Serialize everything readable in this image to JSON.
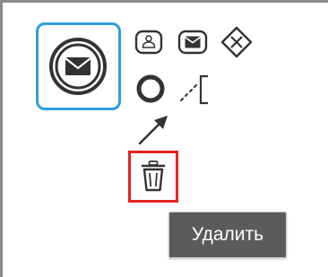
{
  "palette_icons": {
    "selected_shape": "envelope-event-icon",
    "row1": [
      "user-task-icon",
      "message-task-icon",
      "exclusive-gateway-icon"
    ],
    "row2": [
      "end-event-icon",
      "text-annotation-icon"
    ],
    "row3": [
      "connect-arrow-icon"
    ],
    "delete": "trash-icon"
  },
  "colors": {
    "selection": "#2a9fe0",
    "delete_highlight": "#e52222",
    "tooltip_bg": "#5b5b5b",
    "icon": "#333333"
  },
  "tooltip": {
    "text": "Удалить"
  }
}
